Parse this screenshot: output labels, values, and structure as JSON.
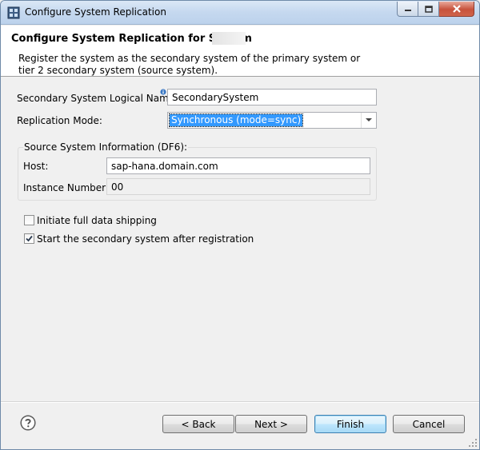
{
  "window": {
    "title": "Configure System Replication",
    "icon": "app-grid-icon"
  },
  "banner": {
    "title": "Configure System Replication for System",
    "description": "Register the system as the secondary system of the primary system or tier 2 secondary system (source system)."
  },
  "form": {
    "logical_name_label": "Secondary System Logical Name:",
    "logical_name_value": "SecondarySystem",
    "replication_mode_label": "Replication Mode:",
    "replication_mode_value": "Synchronous (mode=sync)"
  },
  "source_group": {
    "title": "Source System Information (DF6):",
    "host_label": "Host:",
    "host_value": "sap-hana.domain.com",
    "instance_label": "Instance Number:",
    "instance_value": "00"
  },
  "options": {
    "full_data_shipping_label": "Initiate full data shipping",
    "full_data_shipping_checked": false,
    "start_secondary_label": "Start the secondary system after registration",
    "start_secondary_checked": true
  },
  "buttons": {
    "back": "< Back",
    "next": "Next >",
    "finish": "Finish",
    "cancel": "Cancel"
  },
  "colors": {
    "selection": "#3399ff",
    "titlebar": "#c5d8ef",
    "close": "#c7523c"
  }
}
